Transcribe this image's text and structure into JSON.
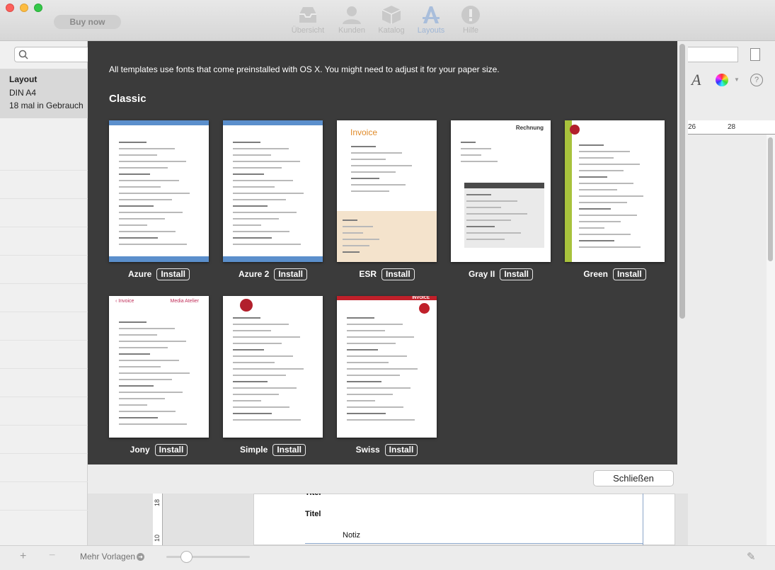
{
  "window": {
    "buy_now": "Buy now",
    "toolbar": [
      {
        "label": "Übersicht",
        "icon": "inbox-icon"
      },
      {
        "label": "Kunden",
        "icon": "person-icon"
      },
      {
        "label": "Katalog",
        "icon": "box-icon"
      },
      {
        "label": "Layouts",
        "icon": "layouts-icon",
        "selected": true
      },
      {
        "label": "Hilfe",
        "icon": "help-icon"
      }
    ]
  },
  "sidebar": {
    "selected_item": {
      "title": "Layout",
      "subtitle": "DIN A4",
      "usage": "18 mal in Gebrauch"
    },
    "bottom": {
      "add": "+",
      "remove": "−",
      "more_templates": "Mehr Vorlagen"
    }
  },
  "editor": {
    "ruler_top": [
      "26",
      "28"
    ],
    "ruler_left": "18",
    "ruler_left2": "10",
    "title_label": "Titel",
    "note_label": "Notiz"
  },
  "dialog": {
    "intro": "All templates use fonts that come preinstalled with OS X. You might need to adjust it for your paper size.",
    "section": "Classic",
    "install_label": "Install",
    "close_label": "Schließen",
    "templates": [
      {
        "name": "Azure",
        "style": "azure",
        "accent": "#5b8fcc"
      },
      {
        "name": "Azure 2",
        "style": "azure2",
        "accent": "#5b8fcc"
      },
      {
        "name": "ESR",
        "style": "esr",
        "accent": "#e08b2a",
        "heading": "Invoice"
      },
      {
        "name": "Gray II",
        "style": "gray",
        "accent": "#4a4a4a",
        "heading": "Rechnung"
      },
      {
        "name": "Green",
        "style": "green",
        "accent": "#a8c23c"
      },
      {
        "name": "Jony",
        "style": "jony",
        "accent": "#c0305a",
        "heading": "Invoice",
        "subheading": "Media Atelier"
      },
      {
        "name": "Simple",
        "style": "simple",
        "accent": "#b2202c"
      },
      {
        "name": "Swiss",
        "style": "swiss",
        "accent": "#c0202a",
        "heading": "INVOICE"
      }
    ]
  }
}
